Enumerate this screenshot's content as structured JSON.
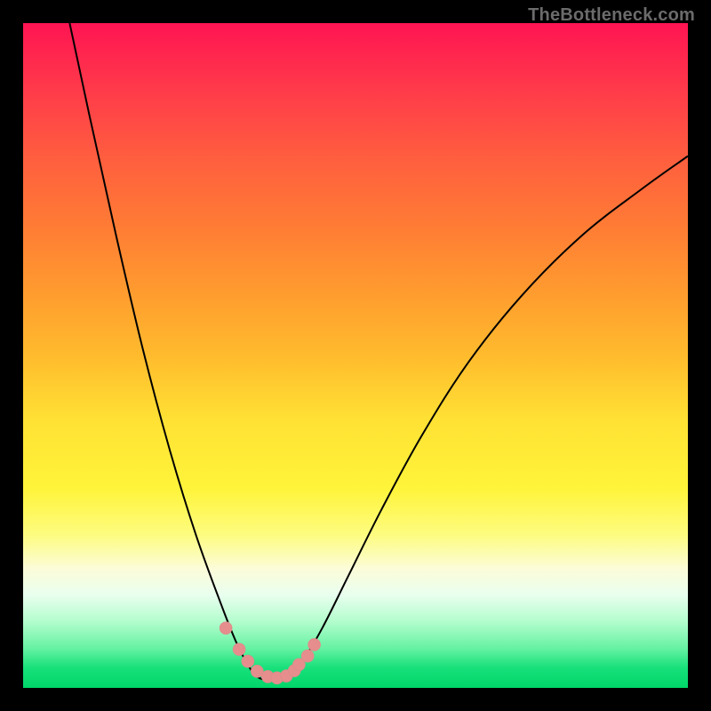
{
  "watermark": "TheBottleneck.com",
  "colors": {
    "curve": "#000000",
    "markers_stroke": "#e08c8c",
    "markers_fill": "#e68e8e",
    "frame": "#000000"
  },
  "chart_data": {
    "type": "line",
    "title": "",
    "xlabel": "",
    "ylabel": "",
    "xlim": [
      0,
      100
    ],
    "ylim": [
      0,
      100
    ],
    "grid": false,
    "legend": false,
    "series": [
      {
        "name": "left-branch",
        "x": [
          7,
          10,
          14,
          18,
          22,
          26,
          30,
          32,
          33.5,
          34.5,
          35
        ],
        "y": [
          100,
          86,
          68,
          51,
          36,
          23,
          12,
          7,
          4,
          2.4,
          1.8
        ]
      },
      {
        "name": "valley-floor",
        "x": [
          35,
          36,
          37,
          38,
          39,
          40
        ],
        "y": [
          1.8,
          1.3,
          1.2,
          1.2,
          1.4,
          1.9
        ]
      },
      {
        "name": "right-branch",
        "x": [
          40,
          42,
          45,
          49,
          54,
          60,
          67,
          75,
          84,
          93,
          100
        ],
        "y": [
          1.9,
          4,
          9,
          17,
          27,
          38,
          49,
          59,
          68,
          75,
          80
        ]
      }
    ],
    "markers": {
      "x": [
        30.5,
        32.5,
        33.8,
        35.2,
        36.8,
        38.2,
        39.6,
        40.8,
        41.5,
        42.8,
        43.8
      ],
      "y": [
        9.0,
        5.8,
        4.0,
        2.5,
        1.7,
        1.5,
        1.8,
        2.6,
        3.5,
        4.8,
        6.5
      ]
    }
  }
}
